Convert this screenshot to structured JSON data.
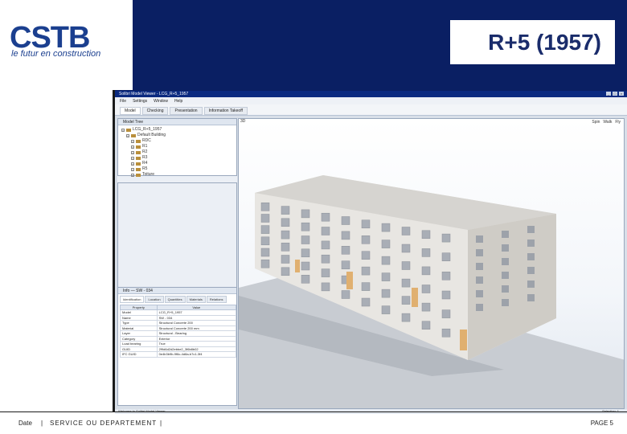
{
  "header": {
    "logo": "CSTB",
    "tagline": "le futur en construction",
    "title": "R+5 (1957)"
  },
  "app": {
    "window_title": "Solibri Model Viewer - LCG_R+5_1957",
    "menu": [
      "File",
      "Settings",
      "Window",
      "Help"
    ],
    "tabs": [
      "Model",
      "Checking",
      "Presentation",
      "Information Takeoff"
    ],
    "model_tree": {
      "title": "Model Tree",
      "items": [
        {
          "label": "LCG_R+5_1957",
          "level": 0
        },
        {
          "label": "Default Building",
          "level": 1
        },
        {
          "label": "RDC",
          "level": 2
        },
        {
          "label": "R1",
          "level": 2
        },
        {
          "label": "R2",
          "level": 2
        },
        {
          "label": "R3",
          "level": 2
        },
        {
          "label": "R4",
          "level": 2
        },
        {
          "label": "R5",
          "level": 2
        },
        {
          "label": "Toiture",
          "level": 2
        }
      ]
    },
    "info": {
      "title": "Info",
      "selected": "SW - 034",
      "tabs": [
        "Identification",
        "Location",
        "Quantities",
        "Materials",
        "Relations"
      ],
      "headers": [
        "Property",
        "Value"
      ],
      "rows": [
        [
          "Model",
          "LCG_R+5_1957"
        ],
        [
          "Name",
          "SW - 034"
        ],
        [
          "Type",
          "Structural Concrete 200"
        ],
        [
          "Material",
          "Structural Concrete 200 mm"
        ],
        [
          "Layer",
          "Structural - Bearing"
        ],
        [
          "Category",
          "Exterior"
        ],
        [
          "Load bearing",
          "True"
        ],
        [
          "GUID",
          "2f9d6d2d2ebbe2_3f6b8b02"
        ],
        [
          "IFC GUID",
          "0e4b3b9b-9f6c-4d8a-b7c1-3f4"
        ]
      ]
    },
    "viewport": {
      "tab": "3D",
      "toolbar": [
        "Spin",
        "Walk",
        "Fly"
      ]
    },
    "status_left": "Welcome to Solibri Model Viewer",
    "status_right": "Selection: 1"
  },
  "footer": {
    "date": "Date",
    "sep": "|",
    "department": "SERVICE OU DEPARTEMENT",
    "sep2": "|",
    "page": "PAGE 5"
  }
}
